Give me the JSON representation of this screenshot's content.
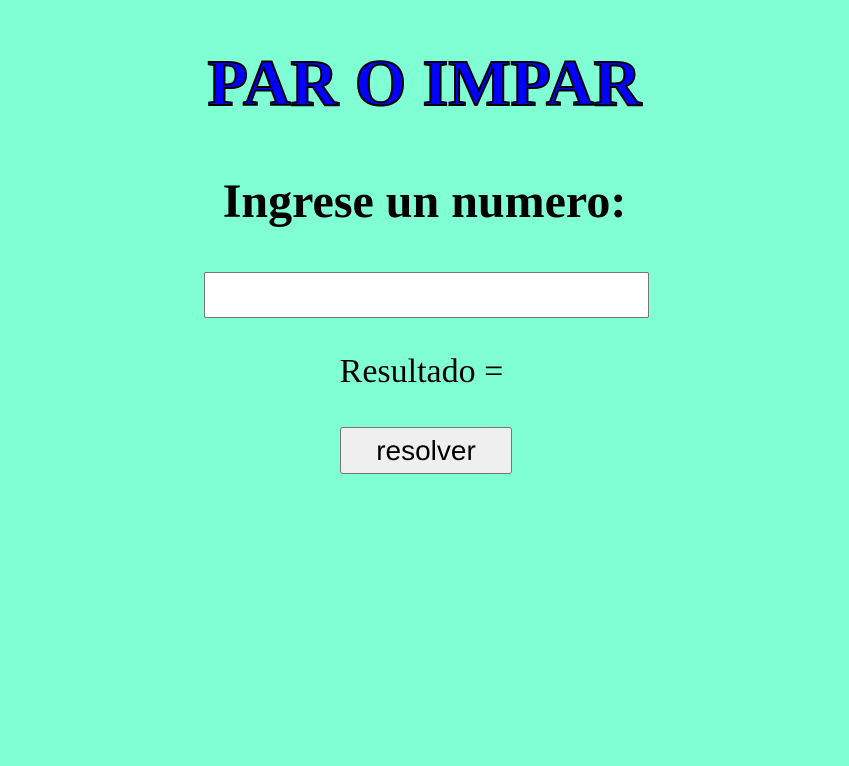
{
  "page": {
    "title": "PAR O IMPAR",
    "prompt": "Ingrese un numero:",
    "result_label": "Resultado =",
    "result_value": ""
  },
  "input": {
    "value": "",
    "placeholder": ""
  },
  "button": {
    "label": "resolver"
  },
  "colors": {
    "background": "#80ffd5",
    "title": "#0000ff",
    "text": "#000000"
  }
}
